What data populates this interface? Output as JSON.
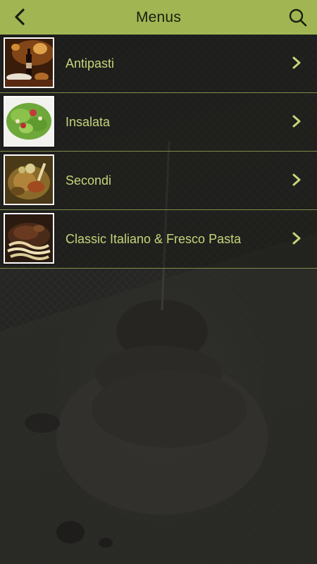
{
  "header": {
    "title": "Menus",
    "back_icon": "chevron-left-icon",
    "search_icon": "search-icon"
  },
  "menu": {
    "items": [
      {
        "label": "Antipasti",
        "thumb": "antipasti-photo"
      },
      {
        "label": "Insalata",
        "thumb": "insalata-photo"
      },
      {
        "label": "Secondi",
        "thumb": "secondi-photo"
      },
      {
        "label": "Classic Italiano & Fresco Pasta",
        "thumb": "pasta-photo"
      }
    ]
  },
  "colors": {
    "header_bg": "#a1b653",
    "item_text": "#c5d57a",
    "divider": "#7f8c4a",
    "background": "#1f1f1d"
  }
}
